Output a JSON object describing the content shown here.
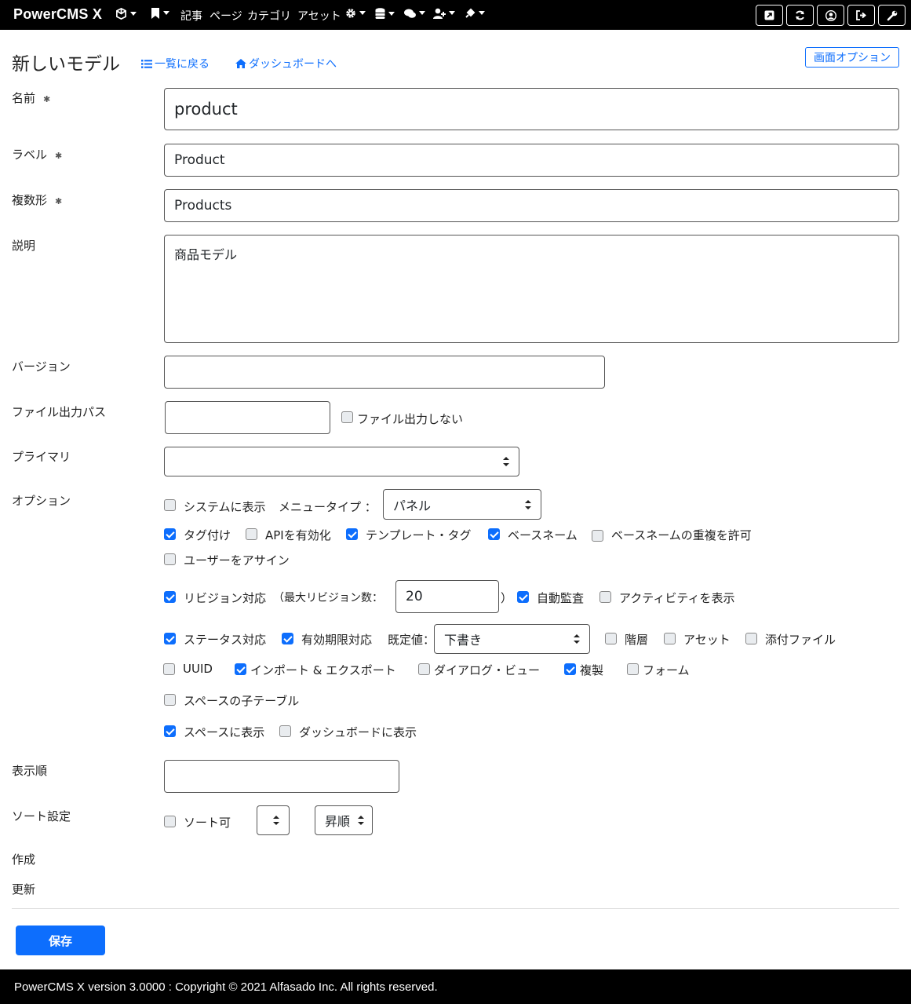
{
  "nav": {
    "brand": "PowerCMS X",
    "entries": "記事",
    "pages": "ページ",
    "categories": "カテゴリ",
    "assets": "アセット"
  },
  "header": {
    "title": "新しいモデル",
    "back_to_list": "一覧に戻る",
    "to_dashboard": "ダッシュボードへ",
    "screen_options": "画面オプション"
  },
  "form": {
    "name": {
      "label": "名前",
      "required": "✱",
      "value": "product"
    },
    "label": {
      "label": "ラベル",
      "required": "✱",
      "value": "Product"
    },
    "plural": {
      "label": "複数形",
      "required": "✱",
      "value": "Products"
    },
    "description": {
      "label": "説明",
      "value": "商品モデル"
    },
    "version": {
      "label": "バージョン",
      "value": ""
    },
    "file_output_path": {
      "label": "ファイル出力パス",
      "value": "",
      "no_output_label": "ファイル出力しない",
      "no_output_checked": false
    },
    "primary": {
      "label": "プライマリ",
      "value": ""
    },
    "options": {
      "label": "オプション",
      "show_in_system": "システムに表示",
      "menu_type_label": "メニュータイプ ：",
      "menu_type_value": "パネル",
      "tagging": "タグ付け",
      "api_enabled": "APIを有効化",
      "template_tags": "テンプレート・タグ",
      "basename": "ベースネーム",
      "allow_duplicate_basename": "ベースネームの重複を許可",
      "assign_user": "ユーザーをアサイン",
      "revisions": "リビジョン対応",
      "max_revisions_label": "（最大リビジョン数：",
      "max_revisions_value": "20",
      "max_revisions_close": "）",
      "auto_audit": "自動監査",
      "show_activity": "アクティビティを表示",
      "status": "ステータス対応",
      "expiration": "有効期限対応",
      "default_label": "既定値：",
      "default_value": "下書き",
      "hierarchy": "階層",
      "asset": "アセット",
      "attachment": "添付ファイル",
      "uuid": "UUID",
      "import_export": "インポート & エクスポート",
      "dialog_view": "ダイアログ・ビュー",
      "duplicate": "複製",
      "form": "フォーム",
      "space_child_table": "スペースの子テーブル",
      "show_in_space": "スペースに表示",
      "show_in_dashboard": "ダッシュボードに表示"
    },
    "display_order": {
      "label": "表示順",
      "value": ""
    },
    "sort": {
      "label": "ソート設定",
      "sortable": "ソート可",
      "field_value": "",
      "order_value": "昇順"
    },
    "created": {
      "label": "作成"
    },
    "modified": {
      "label": "更新"
    }
  },
  "save_label": "保存",
  "footer": "PowerCMS X version 3.0000 : Copyright © 2021 Alfasado Inc. All rights reserved.",
  "colors": {
    "accent": "#0d6efd",
    "topbar": "#000000"
  }
}
